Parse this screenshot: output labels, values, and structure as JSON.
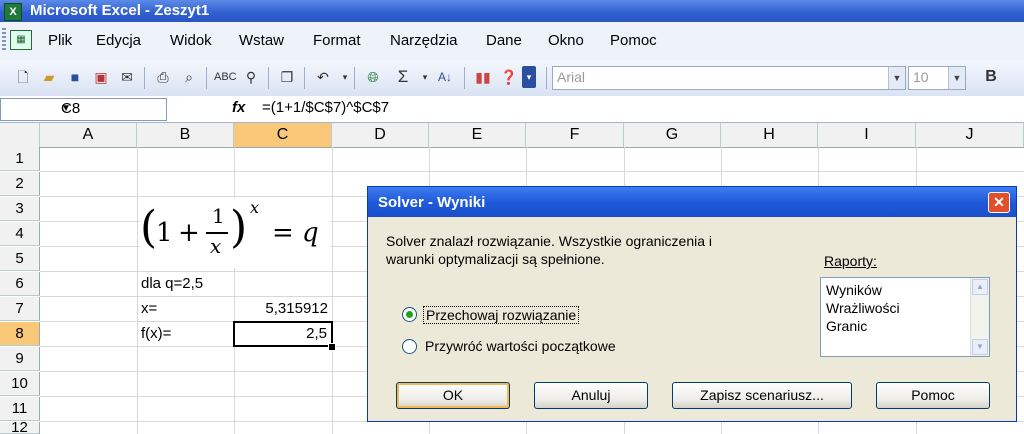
{
  "window": {
    "title": "Microsoft Excel - Zeszyt1"
  },
  "menu": [
    "Plik",
    "Edycja",
    "Widok",
    "Wstaw",
    "Format",
    "Narzędzia",
    "Dane",
    "Okno",
    "Pomoc"
  ],
  "toolbar": {
    "font_name": "Arial",
    "font_size": "10",
    "bold_label": "B"
  },
  "formula_bar": {
    "name_box": "C8",
    "fx_label": "fx",
    "formula": "=(1+1/$C$7)^$C$7"
  },
  "columns": [
    "A",
    "B",
    "C",
    "D",
    "E",
    "F",
    "G",
    "H",
    "I",
    "J"
  ],
  "rows": [
    "1",
    "2",
    "3",
    "4",
    "5",
    "6",
    "7",
    "8",
    "9",
    "10",
    "11",
    "12"
  ],
  "selected": {
    "column": "C",
    "row": "8"
  },
  "cells": {
    "B6": "dla q=2,5",
    "B7": "x=",
    "C7": "5,315912",
    "B8": "f(x)=",
    "C8": "2,5"
  },
  "equation": {
    "one": "1",
    "plus": "+",
    "num": "1",
    "den": "x",
    "exp": "x",
    "eq": "=",
    "rhs": "q"
  },
  "dialog": {
    "title": "Solver - Wyniki",
    "message_line1": "Solver znalazł rozwiązanie.  Wszystkie ograniczenia i",
    "message_line2": "warunki optymalizacji są spełnione.",
    "reports_label": "Raporty:",
    "reports": [
      "Wyników",
      "Wrażliwości",
      "Granic"
    ],
    "options": [
      {
        "label": "Przechowaj rozwiązanie",
        "selected": true
      },
      {
        "label": "Przywróć wartości początkowe",
        "selected": false
      }
    ],
    "buttons": {
      "ok": "OK",
      "cancel": "Anuluj",
      "save_scenario": "Zapisz scenariusz...",
      "help": "Pomoc"
    }
  }
}
